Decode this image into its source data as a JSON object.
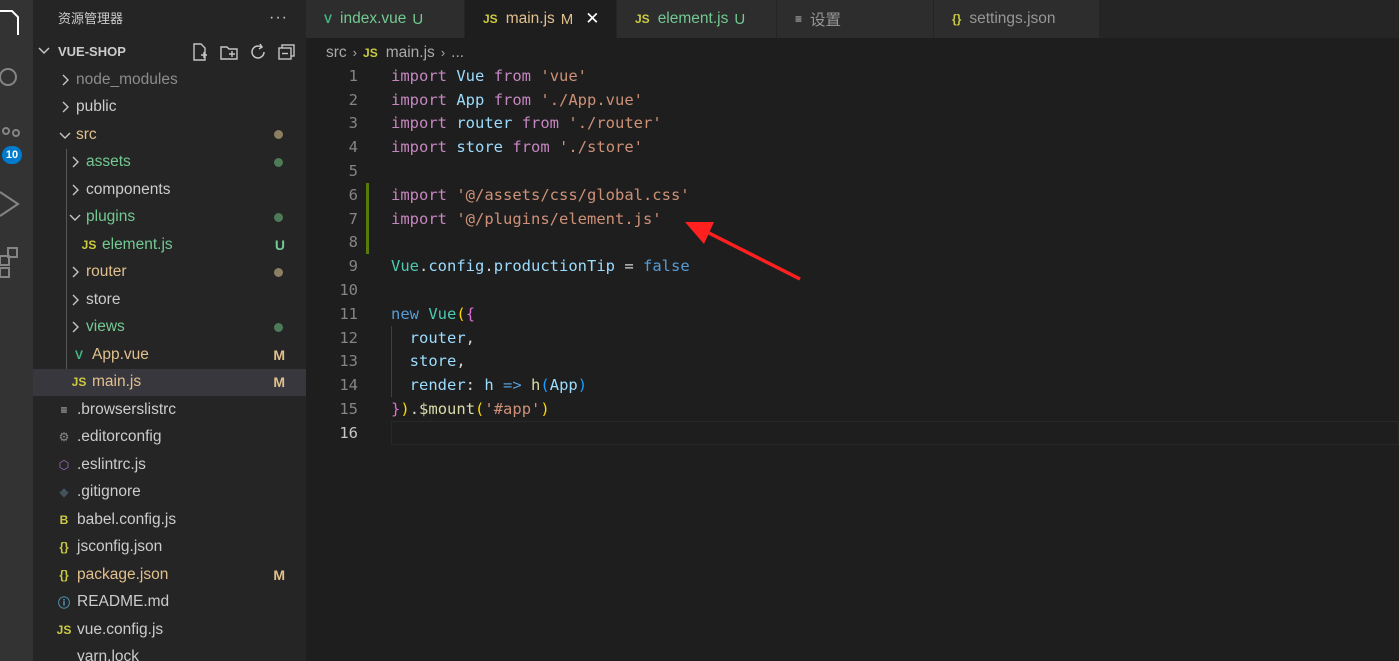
{
  "sidebar": {
    "title": "资源管理器",
    "more": "···",
    "project": "VUE-SHOP",
    "items": [
      {
        "label": "node_modules",
        "kind": "folder",
        "expanded": false,
        "depth": 0,
        "color": "#8c8c8c"
      },
      {
        "label": "public",
        "kind": "folder",
        "expanded": false,
        "depth": 0,
        "color": "#cccccc"
      },
      {
        "label": "src",
        "kind": "folder",
        "expanded": true,
        "depth": 0,
        "color": "#e2c08d",
        "dot": "#8c7e61"
      },
      {
        "label": "assets",
        "kind": "folder",
        "expanded": false,
        "depth": 1,
        "color": "#73c991",
        "dot": "#4d7a57"
      },
      {
        "label": "components",
        "kind": "folder",
        "expanded": false,
        "depth": 1,
        "color": "#cccccc"
      },
      {
        "label": "plugins",
        "kind": "folder",
        "expanded": true,
        "depth": 1,
        "color": "#73c991",
        "dot": "#4d7a57"
      },
      {
        "label": "element.js",
        "kind": "file",
        "icon": "JS",
        "iconColor": "#cbcb41",
        "depth": 2,
        "color": "#73c991",
        "status": "U",
        "statusColor": "#73c991"
      },
      {
        "label": "router",
        "kind": "folder",
        "expanded": false,
        "depth": 1,
        "color": "#e2c08d",
        "dot": "#8c7e61"
      },
      {
        "label": "store",
        "kind": "folder",
        "expanded": false,
        "depth": 1,
        "color": "#cccccc"
      },
      {
        "label": "views",
        "kind": "folder",
        "expanded": false,
        "depth": 1,
        "color": "#73c991",
        "dot": "#4d7a57"
      },
      {
        "label": "App.vue",
        "kind": "file",
        "icon": "V",
        "iconColor": "#41b883",
        "depth": 1,
        "color": "#e2c08d",
        "status": "M",
        "statusColor": "#e2c08d"
      },
      {
        "label": "main.js",
        "kind": "file",
        "icon": "JS",
        "iconColor": "#cbcb41",
        "depth": 1,
        "color": "#e2c08d",
        "status": "M",
        "statusColor": "#e2c08d",
        "selected": true
      },
      {
        "label": ".browserslistrc",
        "kind": "file",
        "icon": "≡",
        "iconColor": "#cccccc",
        "depth": 0,
        "color": "#cccccc"
      },
      {
        "label": ".editorconfig",
        "kind": "file",
        "icon": "⚙",
        "iconColor": "#8c8c8c",
        "depth": 0,
        "color": "#cccccc"
      },
      {
        "label": ".eslintrc.js",
        "kind": "file",
        "icon": "⬡",
        "iconColor": "#a074c4",
        "depth": 0,
        "color": "#cccccc"
      },
      {
        "label": ".gitignore",
        "kind": "file",
        "icon": "◆",
        "iconColor": "#41535b",
        "depth": 0,
        "color": "#cccccc"
      },
      {
        "label": "babel.config.js",
        "kind": "file",
        "icon": "B",
        "iconColor": "#cbcb41",
        "depth": 0,
        "color": "#cccccc"
      },
      {
        "label": "jsconfig.json",
        "kind": "file",
        "icon": "{}",
        "iconColor": "#cbcb41",
        "depth": 0,
        "color": "#cccccc"
      },
      {
        "label": "package.json",
        "kind": "file",
        "icon": "{}",
        "iconColor": "#cbcb41",
        "depth": 0,
        "color": "#e2c08d",
        "status": "M",
        "statusColor": "#e2c08d"
      },
      {
        "label": "README.md",
        "kind": "file",
        "icon": "ⓘ",
        "iconColor": "#519aba",
        "depth": 0,
        "color": "#cccccc"
      },
      {
        "label": "vue.config.js",
        "kind": "file",
        "icon": "JS",
        "iconColor": "#cbcb41",
        "depth": 0,
        "color": "#cccccc"
      },
      {
        "label": "yarn.lock",
        "kind": "file",
        "icon": "",
        "iconColor": "#cccccc",
        "depth": 0,
        "color": "#cccccc"
      }
    ]
  },
  "activity": {
    "badge": "10"
  },
  "tabs": [
    {
      "label": "index.vue",
      "icon": "V",
      "iconColor": "#41b883",
      "status": "U",
      "color": "#73c991",
      "statusColor": "#73c991",
      "active": false
    },
    {
      "label": "main.js",
      "icon": "JS",
      "iconColor": "#cbcb41",
      "status": "M",
      "color": "#e2c08d",
      "statusColor": "#e2c08d",
      "active": true,
      "close": "✕"
    },
    {
      "label": "element.js",
      "icon": "JS",
      "iconColor": "#cbcb41",
      "status": "U",
      "color": "#73c991",
      "statusColor": "#73c991",
      "active": false
    },
    {
      "label": "设置",
      "icon": "≡",
      "iconColor": "#cccccc",
      "status": "",
      "color": "#969696",
      "statusColor": "",
      "active": false
    },
    {
      "label": "settings.json",
      "icon": "{}",
      "iconColor": "#cbcb41",
      "status": "",
      "color": "#969696",
      "statusColor": "",
      "active": false
    }
  ],
  "breadcrumb": {
    "folder": "src",
    "sep": "›",
    "fileIcon": "JS",
    "file": "main.js",
    "rest": "..."
  },
  "editor": {
    "current_line": 16,
    "modified_lines": [
      6,
      7,
      8
    ],
    "lines": [
      [
        {
          "t": "import",
          "c": "kw"
        },
        {
          "t": " "
        },
        {
          "t": "Vue",
          "c": "var"
        },
        {
          "t": " "
        },
        {
          "t": "from",
          "c": "kw"
        },
        {
          "t": " "
        },
        {
          "t": "'vue'",
          "c": "str"
        }
      ],
      [
        {
          "t": "import",
          "c": "kw"
        },
        {
          "t": " "
        },
        {
          "t": "App",
          "c": "var"
        },
        {
          "t": " "
        },
        {
          "t": "from",
          "c": "kw"
        },
        {
          "t": " "
        },
        {
          "t": "'./App.vue'",
          "c": "str"
        }
      ],
      [
        {
          "t": "import",
          "c": "kw"
        },
        {
          "t": " "
        },
        {
          "t": "router",
          "c": "var"
        },
        {
          "t": " "
        },
        {
          "t": "from",
          "c": "kw"
        },
        {
          "t": " "
        },
        {
          "t": "'./router'",
          "c": "str"
        }
      ],
      [
        {
          "t": "import",
          "c": "kw"
        },
        {
          "t": " "
        },
        {
          "t": "store",
          "c": "var"
        },
        {
          "t": " "
        },
        {
          "t": "from",
          "c": "kw"
        },
        {
          "t": " "
        },
        {
          "t": "'./store'",
          "c": "str"
        }
      ],
      [],
      [
        {
          "t": "import",
          "c": "kw"
        },
        {
          "t": " "
        },
        {
          "t": "'@/assets/css/global.css'",
          "c": "str"
        }
      ],
      [
        {
          "t": "import",
          "c": "kw"
        },
        {
          "t": " "
        },
        {
          "t": "'@/plugins/element.js'",
          "c": "str"
        }
      ],
      [],
      [
        {
          "t": "Vue",
          "c": "cls"
        },
        {
          "t": "."
        },
        {
          "t": "config",
          "c": "var"
        },
        {
          "t": "."
        },
        {
          "t": "productionTip",
          "c": "var"
        },
        {
          "t": " = "
        },
        {
          "t": "false",
          "c": "bool"
        }
      ],
      [],
      [
        {
          "t": "new",
          "c": "bool"
        },
        {
          "t": " "
        },
        {
          "t": "Vue",
          "c": "cls"
        },
        {
          "t": "(",
          "c": "br1"
        },
        {
          "t": "{",
          "c": "br2"
        }
      ],
      [
        {
          "t": "  "
        },
        {
          "t": "router",
          "c": "var"
        },
        {
          "t": ","
        }
      ],
      [
        {
          "t": "  "
        },
        {
          "t": "store",
          "c": "var"
        },
        {
          "t": ","
        }
      ],
      [
        {
          "t": "  "
        },
        {
          "t": "render",
          "c": "var"
        },
        {
          "t": ": "
        },
        {
          "t": "h",
          "c": "var"
        },
        {
          "t": " "
        },
        {
          "t": "=>",
          "c": "bool"
        },
        {
          "t": " "
        },
        {
          "t": "h",
          "c": "fn"
        },
        {
          "t": "(",
          "c": "br3"
        },
        {
          "t": "App",
          "c": "var"
        },
        {
          "t": ")",
          "c": "br3"
        }
      ],
      [
        {
          "t": "}",
          "c": "br2"
        },
        {
          "t": ")",
          "c": "br1"
        },
        {
          "t": "."
        },
        {
          "t": "$mount",
          "c": "fn"
        },
        {
          "t": "(",
          "c": "br1"
        },
        {
          "t": "'#app'",
          "c": "str"
        },
        {
          "t": ")",
          "c": "br1"
        }
      ],
      []
    ]
  },
  "colors": {
    "accent": "#007acc",
    "arrow": "#ff2020"
  }
}
